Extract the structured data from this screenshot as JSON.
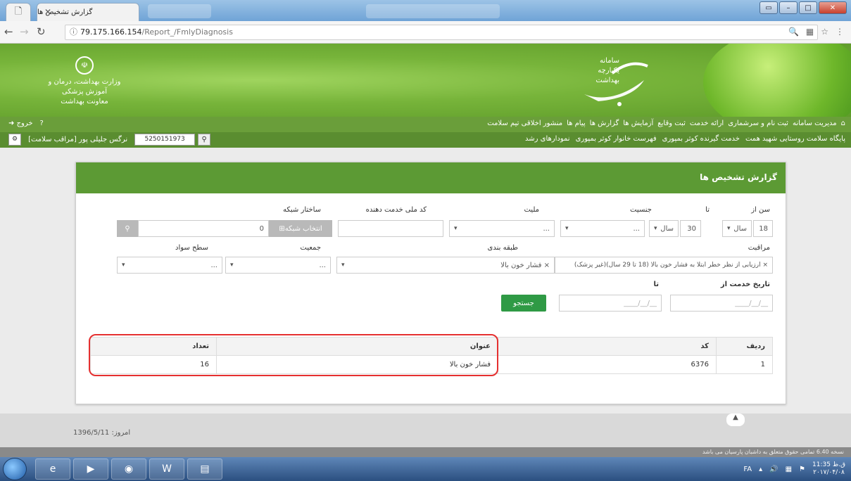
{
  "browser": {
    "tab_title": "گزارش تشخیص ها",
    "url_host": "79.175.166.154",
    "url_path": "/Report_/FmlyDiagnosis"
  },
  "header": {
    "system_name": "سامانه یکپارچه بهداشت",
    "ministry_line1": "وزارت بهداشت، درمان و آموزش پزشکی",
    "ministry_line2": "معاونت بهداشت"
  },
  "menu": {
    "items": [
      "مدیریت سامانه",
      "ثبت نام و سرشماری",
      "ارائه خدمت",
      "ثبت وقایع",
      "آزمایش ها",
      "گزارش ها",
      "پیام ها",
      "منشور اخلاقی تیم سلامت"
    ],
    "help": "?",
    "logout": "خروج"
  },
  "submenu": {
    "items": [
      "پایگاه سلامت روستایی شهید همت",
      "خدمت گیرنده کوثر بمپوری",
      "فهرست خانوار کوثر بمپوری",
      "نمودارهای رشد"
    ],
    "national_code": "5250151973",
    "user": "نرگس جلیلی پور [مراقب سلامت]"
  },
  "panel": {
    "title": "گزارش تشخیص ها",
    "age_from_label": "سن از",
    "age_to_label": "تا",
    "age_from_value": "18",
    "age_from_unit": "سال",
    "age_to_value": "30",
    "age_to_unit": "سال",
    "gender_label": "جنسیت",
    "gender_value": "...",
    "nationality_label": "ملیت",
    "nationality_value": "...",
    "provider_code_label": "کد ملی خدمت دهنده",
    "provider_code_value": "",
    "network_label": "ساختار شبکه",
    "network_button": "انتخاب شبکه",
    "network_value": "0",
    "care_label": "مراقبت",
    "care_value": "× ارزیابی از نظر خطر ابتلا به فشار خون بالا (18 تا 29 سال)(غیر پزشک)",
    "category_label": "طبقه بندی",
    "category_value": "× فشار خون بالا",
    "population_label": "جمعیت",
    "population_value": "...",
    "literacy_label": "سطح سواد",
    "literacy_value": "...",
    "service_date_from_label": "تاریخ خدمت از",
    "service_date_to_label": "تا",
    "date_placeholder": "__/__/____",
    "search_button": "جستجو"
  },
  "table": {
    "headers": [
      "ردیف",
      "کد",
      "عنوان",
      "تعداد"
    ],
    "rows": [
      [
        "1",
        "6376",
        "فشار خون بالا",
        "16"
      ]
    ]
  },
  "footer": {
    "date": "امروز: 1396/5/11",
    "version_note": "نسخه 6.40 تمامی حقوق متعلق به داشبان پارسیان می باشد"
  },
  "taskbar": {
    "lang": "FA",
    "time": "11:35 ق.ظ",
    "date": "۲۰۱۷/۰۴/۰۸"
  }
}
